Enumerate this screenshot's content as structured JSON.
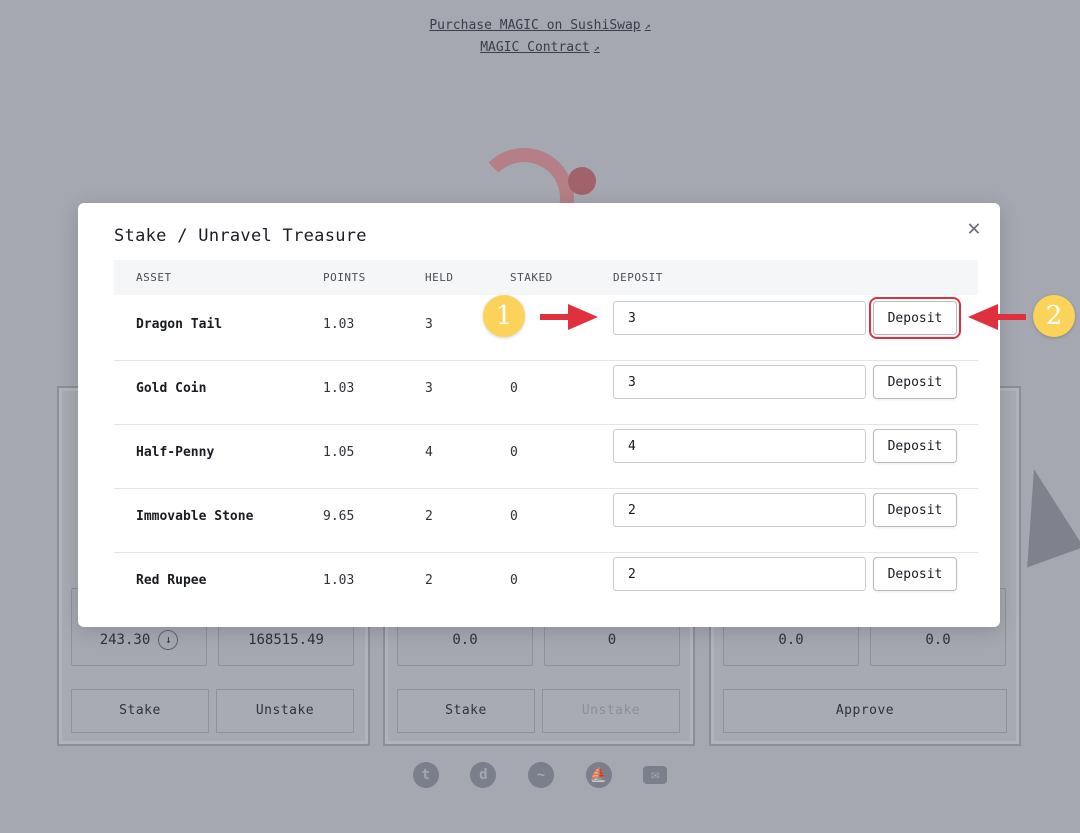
{
  "background": {
    "links": [
      {
        "label": "Purchase MAGIC on SushiSwap"
      },
      {
        "label": "MAGIC Contract"
      }
    ],
    "panels": [
      {
        "stat_left": "243.30",
        "stat_right": "168515.49",
        "btn_left": "Stake",
        "btn_right": "Unstake"
      },
      {
        "stat_left": "0.0",
        "stat_right": "0",
        "btn_left": "Stake",
        "btn_right": "Unstake"
      },
      {
        "stat_left": "0.0",
        "stat_right": "0.0",
        "btn_wide": "Approve"
      }
    ],
    "socials": [
      "twitter-icon",
      "discord-icon",
      "chart-icon",
      "opensea-icon",
      "mail-icon"
    ]
  },
  "modal": {
    "title": "Stake / Unravel Treasure",
    "columns": {
      "asset": "ASSET",
      "points": "POINTS",
      "held": "HELD",
      "staked": "STAKED",
      "deposit": "DEPOSIT"
    },
    "rows": [
      {
        "asset": "Dragon Tail",
        "points": "1.03",
        "held": "3",
        "staked": "",
        "deposit_value": "3",
        "button": "Deposit"
      },
      {
        "asset": "Gold Coin",
        "points": "1.03",
        "held": "3",
        "staked": "0",
        "deposit_value": "3",
        "button": "Deposit"
      },
      {
        "asset": "Half-Penny",
        "points": "1.05",
        "held": "4",
        "staked": "0",
        "deposit_value": "4",
        "button": "Deposit"
      },
      {
        "asset": "Immovable Stone",
        "points": "9.65",
        "held": "2",
        "staked": "0",
        "deposit_value": "2",
        "button": "Deposit"
      },
      {
        "asset": "Red Rupee",
        "points": "1.03",
        "held": "2",
        "staked": "0",
        "deposit_value": "2",
        "button": "Deposit"
      }
    ]
  },
  "annotations": {
    "badge1": "1",
    "badge2": "2"
  },
  "colors": {
    "accent_red": "#e0303d",
    "badge_yellow": "#fcd35a"
  }
}
